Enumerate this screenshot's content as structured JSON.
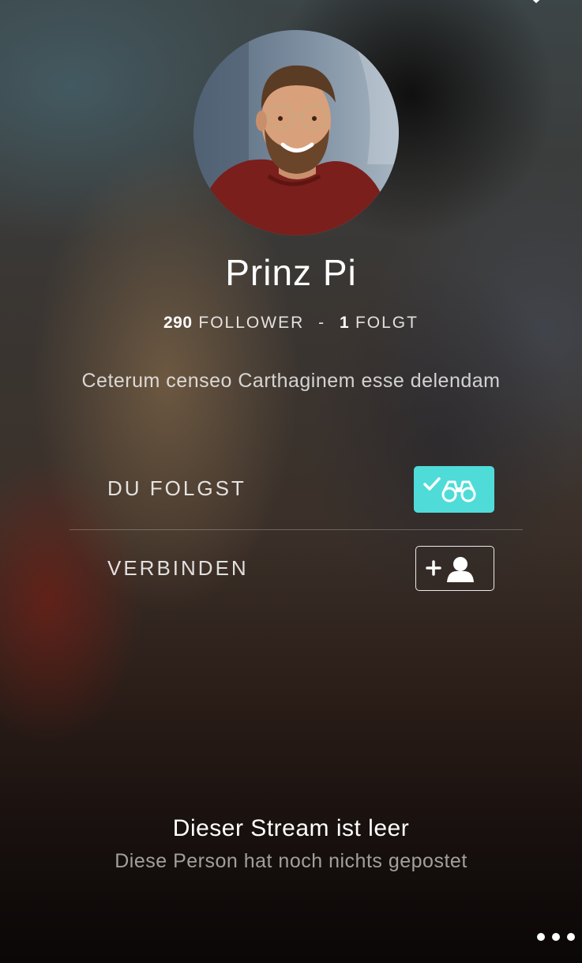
{
  "profile": {
    "name": "Prinz Pi",
    "followers_count": "290",
    "followers_label": "FOLLOWER",
    "separator": "-",
    "following_count": "1",
    "following_label": "FOLGT",
    "bio": "Ceterum censeo Carthaginem esse delendam",
    "avatar_icon": "profile-photo"
  },
  "actions": {
    "follow": {
      "label": "DU FOLGST",
      "state": "following",
      "icon": "binoculars-check-icon",
      "color": "#4fdcd8"
    },
    "connect": {
      "label": "VERBINDEN",
      "icon": "add-user-icon"
    }
  },
  "stream": {
    "empty_title": "Dieser Stream ist leer",
    "empty_subtitle": "Diese Person hat noch nichts gepostet"
  },
  "top_icon": "close-icon",
  "more_icon": "more-dots-icon"
}
